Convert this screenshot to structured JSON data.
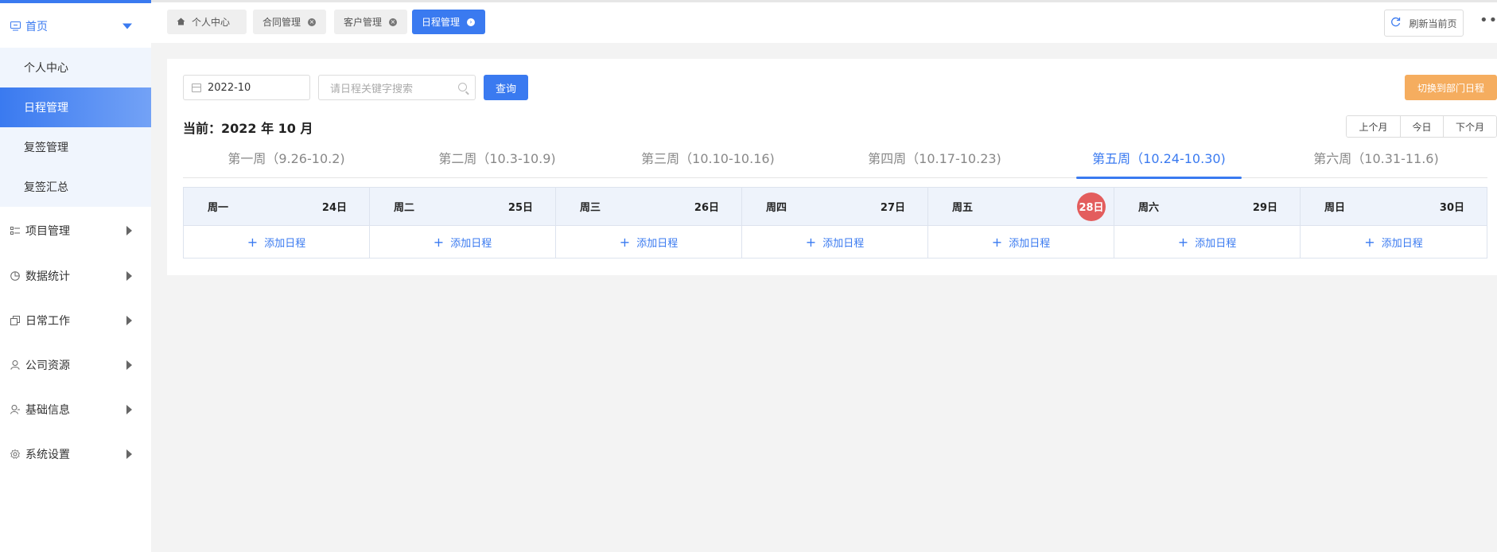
{
  "sidebar": {
    "home_label": "首页",
    "sub_items": [
      {
        "label": "个人中心",
        "active": false
      },
      {
        "label": "日程管理",
        "active": true
      },
      {
        "label": "复签管理",
        "active": false
      },
      {
        "label": "复签汇总",
        "active": false
      }
    ],
    "menu_items": [
      {
        "label": "项目管理",
        "icon": "list-icon"
      },
      {
        "label": "数据统计",
        "icon": "pie-chart-icon"
      },
      {
        "label": "日常工作",
        "icon": "copy-icon"
      },
      {
        "label": "公司资源",
        "icon": "user-icon"
      },
      {
        "label": "基础信息",
        "icon": "user-info-icon"
      },
      {
        "label": "系统设置",
        "icon": "gear-icon"
      }
    ],
    "accent_color": "#3a7af0"
  },
  "tabs": [
    {
      "label": "个人中心",
      "home": true,
      "closable": false,
      "active": false
    },
    {
      "label": "合同管理",
      "closable": true,
      "active": false
    },
    {
      "label": "客户管理",
      "closable": true,
      "active": false
    },
    {
      "label": "日程管理",
      "closable": true,
      "active": true
    }
  ],
  "toolbar": {
    "refresh_label": "刷新当前页",
    "more_label": "•••"
  },
  "filters": {
    "date_value": "2022-10",
    "search_placeholder": "请日程关键字搜索",
    "query_label": "查询",
    "switch_label": "切换到部门日程",
    "switch_color": "#f5ad5f"
  },
  "current": {
    "label": "当前：2022 年 10 月"
  },
  "month_nav": {
    "prev": "上个月",
    "today": "今日",
    "next": "下个月"
  },
  "weeks": [
    {
      "label": "第一周（9.26-10.2)",
      "active": false
    },
    {
      "label": "第二周（10.3-10.9)",
      "active": false
    },
    {
      "label": "第三周（10.10-10.16)",
      "active": false
    },
    {
      "label": "第四周（10.17-10.23)",
      "active": false
    },
    {
      "label": "第五周（10.24-10.30)",
      "active": true
    },
    {
      "label": "第六周（10.31-11.6)",
      "active": false
    }
  ],
  "days": [
    {
      "weekday": "周一",
      "date": "24日",
      "today": false
    },
    {
      "weekday": "周二",
      "date": "25日",
      "today": false
    },
    {
      "weekday": "周三",
      "date": "26日",
      "today": false
    },
    {
      "weekday": "周四",
      "date": "27日",
      "today": false
    },
    {
      "weekday": "周五",
      "date": "28日",
      "today": true
    },
    {
      "weekday": "周六",
      "date": "29日",
      "today": false
    },
    {
      "weekday": "周日",
      "date": "30日",
      "today": false
    }
  ],
  "add_label": "添加日程",
  "today_color": "#e35d5d"
}
